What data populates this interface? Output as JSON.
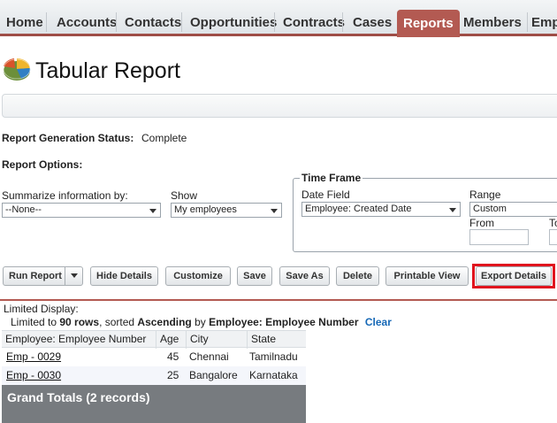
{
  "tabs": [
    {
      "label": "Home",
      "active": false
    },
    {
      "label": "Accounts",
      "active": false
    },
    {
      "label": "Contacts",
      "active": false
    },
    {
      "label": "Opportunities",
      "active": false
    },
    {
      "label": "Contracts",
      "active": false
    },
    {
      "label": "Cases",
      "active": false
    },
    {
      "label": "Reports",
      "active": true
    },
    {
      "label": "Members",
      "active": false
    },
    {
      "label": "Emp",
      "active": false
    }
  ],
  "header": {
    "title": "Tabular Report",
    "icon": "report-pie-icon"
  },
  "status": {
    "label": "Report Generation Status:",
    "value": "Complete"
  },
  "options": {
    "heading": "Report Options:",
    "summarize_label": "Summarize information by:",
    "summarize_value": "--None--",
    "show_label": "Show",
    "show_value": "My employees"
  },
  "timeframe": {
    "legend": "Time Frame",
    "date_field_label": "Date Field",
    "date_field_value": "Employee: Created Date",
    "range_label": "Range",
    "range_value": "Custom",
    "from_label": "From",
    "to_label": "To"
  },
  "buttons": {
    "run_report": "Run Report",
    "hide_details": "Hide Details",
    "customize": "Customize",
    "save": "Save",
    "save_as": "Save As",
    "delete": "Delete",
    "printable_view": "Printable View",
    "export_details": "Export Details"
  },
  "highlight_color": "#e0141e",
  "results": {
    "limited_display": "Limited Display:",
    "limited_prefix": "Limited to ",
    "limited_rows": "90 rows",
    "limited_mid": ", sorted ",
    "limited_order": "Ascending",
    "limited_by": " by ",
    "limited_field": "Employee: Employee Number",
    "clear_link": "Clear"
  },
  "table": {
    "columns": [
      "Employee: Employee Number",
      "Age",
      "City",
      "State"
    ],
    "rows": [
      {
        "number": "Emp - 0029",
        "age": "45",
        "city": "Chennai",
        "state": "Tamilnadu"
      },
      {
        "number": "Emp - 0030",
        "age": "25",
        "city": "Bangalore",
        "state": "Karnataka"
      }
    ],
    "grand_totals": "Grand Totals (2 records)"
  }
}
